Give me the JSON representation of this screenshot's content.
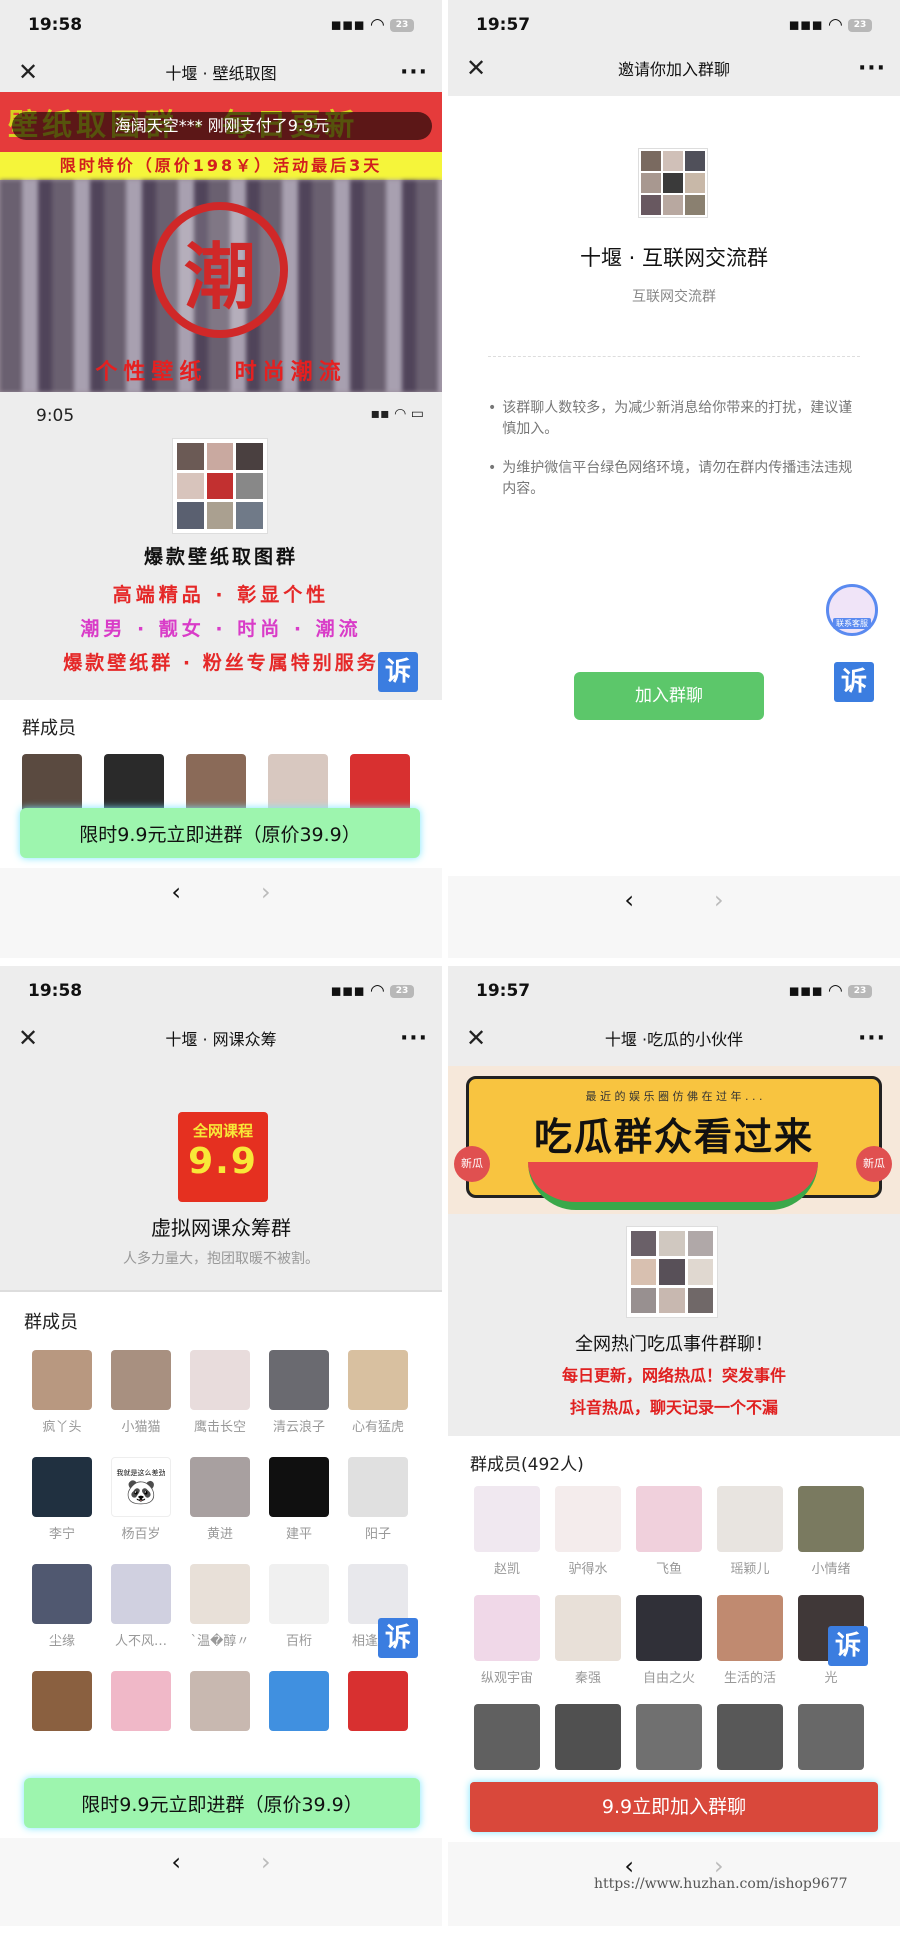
{
  "panel_tl": {
    "time": "19:58",
    "battery": "23",
    "title": "十堰 · 壁纸取图",
    "banner_scroll_text": "壁纸取图群 · 每日更新",
    "payment_notice": "海阔天空*** 刚刚支付了9.9元",
    "promo_line": "限时特价（原价198￥）活动最后3天",
    "stamp_char": "潮",
    "banner_bottom": "个性壁纸  时尚潮流",
    "inner_time": "9:05",
    "group_name": "爆款壁纸取图群",
    "tagline1": "高端精品 · 彰显个性",
    "tagline2": "潮男 · 靓女 · 时尚 · 潮流",
    "tagline3": "爆款壁纸群 · 粉丝专属特别服务",
    "report": "诉",
    "members_label": "群成员",
    "cta": "限时9.9元立即进群（原价39.9）",
    "back": "‹",
    "forward": "›"
  },
  "panel_tr": {
    "time": "19:57",
    "battery": "23",
    "title": "邀请你加入群聊",
    "group_name": "十堰 · 互联网交流群",
    "subtitle": "互联网交流群",
    "notice1": "该群聊人数较多，为减少新消息给你带来的打扰，建议谨慎加入。",
    "notice2": "为维护微信平台绿色网络环境，请勿在群内传播违法违规内容。",
    "support_label": "联系客服",
    "report": "诉",
    "join_button": "加入群聊",
    "back": "‹",
    "forward": "›"
  },
  "panel_bl": {
    "time": "19:58",
    "battery": "23",
    "title": "十堰 · 网课众筹",
    "badge_top": "全网课程",
    "badge_price": "9.9",
    "group_name": "虚拟网课众筹群",
    "subtitle": "人多力量大，抱团取暖不被割。",
    "members_label": "群成员",
    "members": [
      {
        "name": "疯丫头"
      },
      {
        "name": "小猫猫"
      },
      {
        "name": "鹰击长空"
      },
      {
        "name": "清云浪子"
      },
      {
        "name": "心有猛虎"
      },
      {
        "name": "李宁"
      },
      {
        "name": "杨百岁"
      },
      {
        "name": "黄进"
      },
      {
        "name": "建平"
      },
      {
        "name": "阳子"
      },
      {
        "name": "尘缘"
      },
      {
        "name": "人不风…"
      },
      {
        "name": "`温�醇〃"
      },
      {
        "name": "百桁"
      },
      {
        "name": "相逢何必"
      }
    ],
    "meme_caption": "我就是这么差劲",
    "report": "诉",
    "cta": "限时9.9元立即进群（原价39.9）",
    "back": "‹",
    "forward": "›"
  },
  "panel_br": {
    "time": "19:57",
    "battery": "23",
    "title": "十堰 ·吃瓜的小伙伴",
    "banner_top": "最 近 的 娱 乐 圈 仿 佛 在 过 年 . . .",
    "banner_main": "吃瓜群众看过来",
    "tag_left": "新瓜",
    "tag_right": "新瓜",
    "group_name": "全网热门吃瓜事件群聊！",
    "line1": "每日更新，网络热瓜！突发事件",
    "line2": "抖音热瓜，聊天记录一个不漏",
    "members_label": "群成员(492人)",
    "members": [
      {
        "name": "赵凯"
      },
      {
        "name": "驴得水"
      },
      {
        "name": "飞鱼"
      },
      {
        "name": "瑶颖儿"
      },
      {
        "name": "小情绪"
      },
      {
        "name": "纵观宇宙"
      },
      {
        "name": "秦强"
      },
      {
        "name": "自由之火"
      },
      {
        "name": "生活的活"
      },
      {
        "name": "光"
      }
    ],
    "report": "诉",
    "cta": "9.9立即加入群聊",
    "back": "‹",
    "forward": "›"
  },
  "watermark": "https://www.huzhan.com/ishop9677",
  "colors": {
    "green_cta": "#9df5ae",
    "wechat_green": "#5cc76a",
    "red_cta": "#d9483b",
    "report_blue": "#3b7de0",
    "promo_yellow": "#f5f53a",
    "banner_red": "#e53b3b"
  }
}
